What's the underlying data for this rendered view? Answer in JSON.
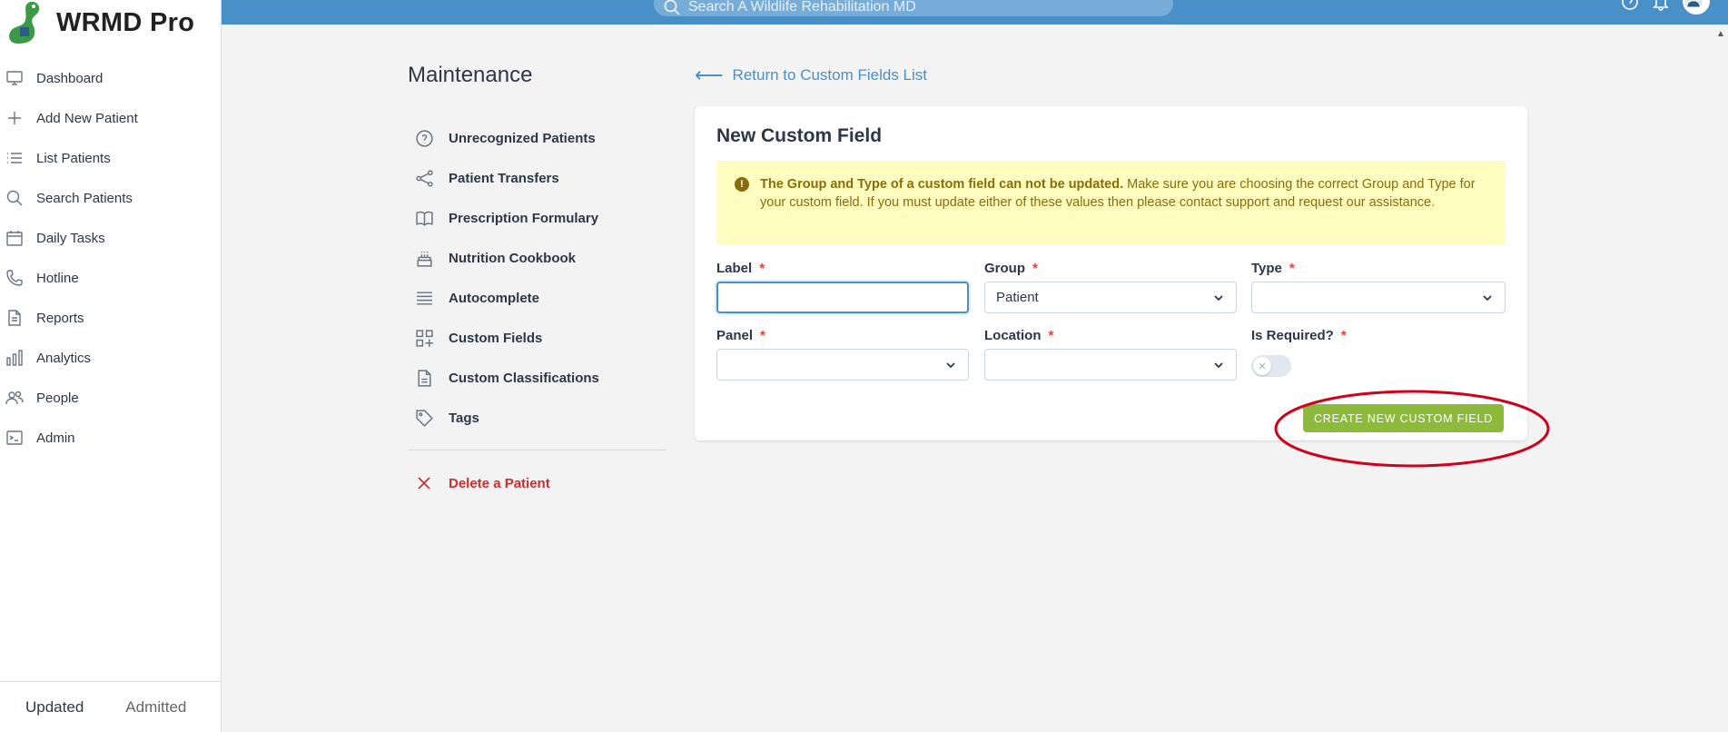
{
  "app": {
    "brand": "WRMD Pro"
  },
  "search": {
    "placeholder": "Search A Wildlife Rehabilitation MD"
  },
  "sidebar": {
    "items": [
      {
        "label": "Dashboard",
        "icon": "monitor-icon"
      },
      {
        "label": "Add New Patient",
        "icon": "plus-icon"
      },
      {
        "label": "List Patients",
        "icon": "list-icon"
      },
      {
        "label": "Search Patients",
        "icon": "search-icon"
      },
      {
        "label": "Daily Tasks",
        "icon": "calendar-icon"
      },
      {
        "label": "Hotline",
        "icon": "phone-icon"
      },
      {
        "label": "Reports",
        "icon": "document-icon"
      },
      {
        "label": "Analytics",
        "icon": "bar-chart-icon"
      },
      {
        "label": "People",
        "icon": "users-icon"
      },
      {
        "label": "Admin",
        "icon": "terminal-icon"
      }
    ],
    "footer_tabs": {
      "updated": "Updated",
      "admitted": "Admitted"
    }
  },
  "maintenance": {
    "title": "Maintenance",
    "items": [
      {
        "label": "Unrecognized Patients",
        "icon": "question-circle-icon"
      },
      {
        "label": "Patient Transfers",
        "icon": "share-icon"
      },
      {
        "label": "Prescription Formulary",
        "icon": "book-icon"
      },
      {
        "label": "Nutrition Cookbook",
        "icon": "cake-icon"
      },
      {
        "label": "Autocomplete",
        "icon": "lines-icon"
      },
      {
        "label": "Custom Fields",
        "icon": "grid-plus-icon"
      },
      {
        "label": "Custom Classifications",
        "icon": "file-icon"
      },
      {
        "label": "Tags",
        "icon": "tag-icon"
      }
    ],
    "delete_label": "Delete a Patient"
  },
  "return_link": "Return to Custom Fields List",
  "form": {
    "title": "New Custom Field",
    "alert_bold": "The Group and Type of a custom field can not be updated.",
    "alert_rest": " Make sure you are choosing the correct Group and Type for your custom field. If you must update either of these values then please contact support and request our assistance.",
    "required_mark": "*",
    "fields": {
      "label": {
        "label": "Label",
        "value": ""
      },
      "group": {
        "label": "Group",
        "value": "Patient"
      },
      "type": {
        "label": "Type",
        "value": ""
      },
      "panel": {
        "label": "Panel",
        "value": ""
      },
      "location": {
        "label": "Location",
        "value": ""
      },
      "is_required": {
        "label": "Is Required?",
        "value": false,
        "knob_glyph": "✕"
      }
    },
    "submit_label": "CREATE NEW CUSTOM FIELD"
  },
  "colors": {
    "topbar": "#4a90c8",
    "submit": "#8cba3a",
    "alert_bg": "#fefcbf",
    "alert_text": "#8a6d0b",
    "danger": "#c53030",
    "annotation": "#d0021b"
  }
}
